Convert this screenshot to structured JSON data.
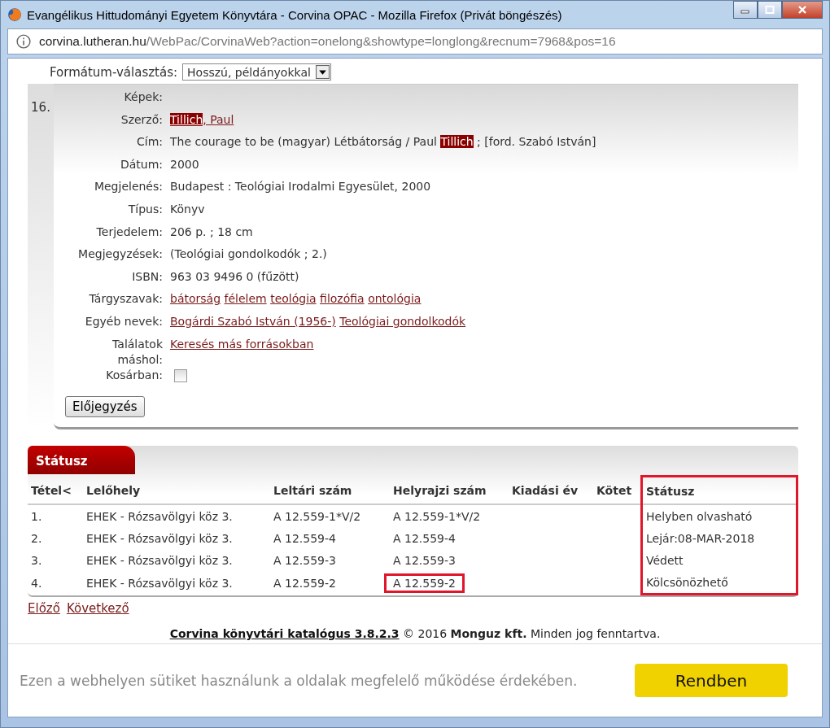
{
  "window": {
    "title": "Evangélikus Hittudományi Egyetem Könyvtára - Corvina OPAC - Mozilla Firefox (Privát böngészés)",
    "url_host": "corvina.lutheran.hu",
    "url_path": "/WebPac/CorvinaWeb?action=onelong&showtype=longlong&recnum=7968&pos=16"
  },
  "format": {
    "label": "Formátum-választás:",
    "value": "Hosszú, példányokkal"
  },
  "record": {
    "number": "16.",
    "fields": [
      {
        "label": "Képek:",
        "kind": "empty"
      },
      {
        "label": "Szerző:",
        "kind": "parts",
        "parts": [
          {
            "text": "Tillich",
            "link": true,
            "highlighted": true
          },
          {
            "text": ", Paul",
            "link": true,
            "highlighted": false
          }
        ]
      },
      {
        "label": "Cím:",
        "kind": "parts",
        "parts": [
          {
            "text": "The courage to be (magyar) Létbátorság / Paul ",
            "link": false,
            "highlighted": false
          },
          {
            "text": "Tillich",
            "link": false,
            "highlighted": true
          },
          {
            "text": " ; [ford. Szabó István]",
            "link": false,
            "highlighted": false
          }
        ]
      },
      {
        "label": "Dátum:",
        "kind": "text",
        "value": "2000"
      },
      {
        "label": "Megjelenés:",
        "kind": "text",
        "value": "Budapest : Teológiai Irodalmi Egyesület, 2000"
      },
      {
        "label": "Típus:",
        "kind": "text",
        "value": "Könyv"
      },
      {
        "label": "Terjedelem:",
        "kind": "text",
        "value": "206 p. ; 18 cm"
      },
      {
        "label": "Megjegyzések:",
        "kind": "text",
        "value": "(Teológiai gondolkodók ; 2.)"
      },
      {
        "label": "ISBN:",
        "kind": "text",
        "value": "963 03 9496 0 (fűzött)"
      },
      {
        "label": "Tárgyszavak:",
        "kind": "links",
        "links": [
          "bátorság",
          "félelem",
          "teológia",
          "filozófia",
          "ontológia"
        ]
      },
      {
        "label": "Egyéb nevek:",
        "kind": "links",
        "links": [
          "Bogárdi Szabó István (1956-)",
          "Teológiai gondolkodók"
        ]
      },
      {
        "label": "Találatok máshol:",
        "kind": "links",
        "links": [
          "Keresés más forrásokban"
        ]
      },
      {
        "label": "Kosárban:",
        "kind": "checkbox",
        "checked": false
      }
    ],
    "button": "Előjegyzés"
  },
  "status": {
    "tab": "Státusz",
    "columns": [
      {
        "label": "Tétel<",
        "highlighted": false
      },
      {
        "label": "Lelőhely",
        "highlighted": false
      },
      {
        "label": "Leltári szám",
        "highlighted": false
      },
      {
        "label": "Helyrajzi szám",
        "highlighted": false
      },
      {
        "label": "Kiadási év",
        "highlighted": false
      },
      {
        "label": "Kötet",
        "highlighted": false
      },
      {
        "label": "Státusz",
        "highlighted": true
      }
    ],
    "rows": [
      {
        "cells": [
          "1.",
          "EHEK - Rózsavölgyi köz 3.",
          "A 12.559-1*V/2",
          "A 12.559-1*V/2",
          "",
          "",
          "Helyben olvasható"
        ],
        "call_number_highlighted": false
      },
      {
        "cells": [
          "2.",
          "EHEK - Rózsavölgyi köz 3.",
          "A 12.559-4",
          "A 12.559-4",
          "",
          "",
          "Lejár:08-MAR-2018"
        ],
        "call_number_highlighted": false
      },
      {
        "cells": [
          "3.",
          "EHEK - Rózsavölgyi köz 3.",
          "A 12.559-3",
          "A 12.559-3",
          "",
          "",
          "Védett"
        ],
        "call_number_highlighted": false
      },
      {
        "cells": [
          "4.",
          "EHEK - Rózsavölgyi köz 3.",
          "A 12.559-2",
          "A 12.559-2",
          "",
          "",
          "Kölcsönözhető"
        ],
        "call_number_highlighted": true
      }
    ]
  },
  "pager": [
    "Előző",
    "Következő"
  ],
  "footer": {
    "link": "Corvina könyvtári katalógus 3.8.2.3",
    "text": "© 2016 **Monguz kft.** Minden jog fenntartva."
  },
  "cookie_bar": {
    "text": "Ezen a webhelyen sütiket használunk a oldalak megfelelő működése érdekében.",
    "button": "Rendben"
  }
}
